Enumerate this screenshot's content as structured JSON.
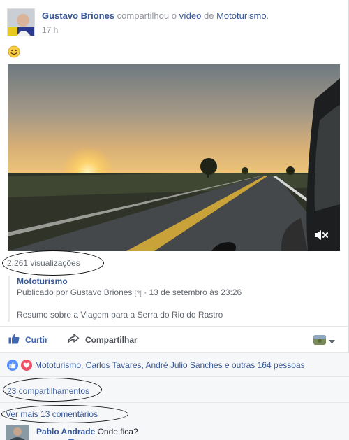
{
  "post": {
    "author": "Gustavo Briones",
    "action_text": "compartilhou o",
    "object_text": "vídeo",
    "preposition": "de",
    "page_name": "Mototurismo",
    "period": ".",
    "timestamp": "17 h",
    "emoji": "smiley-emoji"
  },
  "video": {
    "views": "2.261 visualizações",
    "mute_icon": "mute-icon"
  },
  "source": {
    "name": "Mototurismo",
    "published_prefix": "Publicado por Gustavo Briones",
    "help_marker": "[?]",
    "date": "· 13 de setembro às 23:26",
    "description": "Resumo sobre a Viagem para a Serra do Rio do Rastro"
  },
  "actions": {
    "like_label": "Curtir",
    "share_label": "Compartilhar",
    "like_icon": "thumbs-up-icon",
    "share_icon": "share-arrow-icon",
    "privacy_icon": "audience-avatar-icon",
    "dropdown_icon": "caret-down-icon"
  },
  "reactions": {
    "text": "Mototurismo, Carlos Tavares, André Julio Sanches e outras 164 pessoas",
    "like_icon": "like-reaction-icon",
    "love_icon": "love-reaction-icon"
  },
  "shares": {
    "text": "23 compartilhamentos"
  },
  "comments": {
    "more_text": "Ver mais 13 comentários",
    "first": {
      "author": "Pablo Andrade",
      "body": "Onde fica?"
    }
  },
  "colors": {
    "link": "#365899",
    "action_blue": "#4267b2",
    "muted": "#90949c",
    "love_red": "#f25268"
  }
}
